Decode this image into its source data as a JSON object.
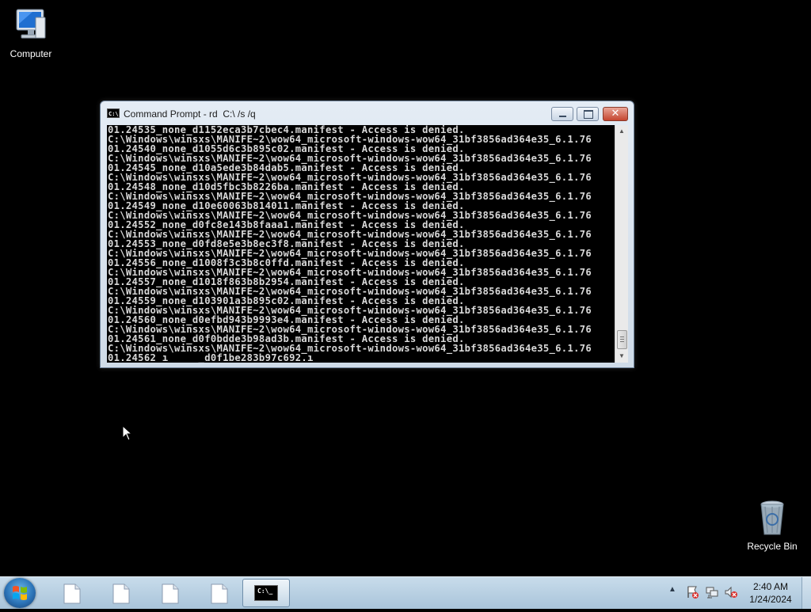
{
  "desktop": {
    "icons": [
      {
        "label": "Computer"
      },
      {
        "label": "Recycle Bin"
      }
    ]
  },
  "window": {
    "title": "Command Prompt - rd  C:\\ /s /q",
    "icon_text": "C:\\",
    "controls": {
      "minimize": "minimize",
      "maximize": "maximize",
      "close": "✕"
    }
  },
  "console": {
    "lines": [
      "01.24535_none_d1152eca3b7cbec4.manifest - Access is denied.",
      "C:\\Windows\\winsxs\\MANIFE~2\\wow64_microsoft-windows-wow64_31bf3856ad364e35_6.1.76",
      "01.24540_none_d1055d6c3b895c02.manifest - Access is denied.",
      "C:\\Windows\\winsxs\\MANIFE~2\\wow64_microsoft-windows-wow64_31bf3856ad364e35_6.1.76",
      "01.24545_none_d10a5ede3b84dab5.manifest - Access is denied.",
      "C:\\Windows\\winsxs\\MANIFE~2\\wow64_microsoft-windows-wow64_31bf3856ad364e35_6.1.76",
      "01.24548_none_d10d5fbc3b8226ba.manifest - Access is denied.",
      "C:\\Windows\\winsxs\\MANIFE~2\\wow64_microsoft-windows-wow64_31bf3856ad364e35_6.1.76",
      "01.24549_none_d10e60063b814011.manifest - Access is denied.",
      "C:\\Windows\\winsxs\\MANIFE~2\\wow64_microsoft-windows-wow64_31bf3856ad364e35_6.1.76",
      "01.24552_none_d0fc8e143b8faaa1.manifest - Access is denied.",
      "C:\\Windows\\winsxs\\MANIFE~2\\wow64_microsoft-windows-wow64_31bf3856ad364e35_6.1.76",
      "01.24553_none_d0fd8e5e3b8ec3f8.manifest - Access is denied.",
      "C:\\Windows\\winsxs\\MANIFE~2\\wow64_microsoft-windows-wow64_31bf3856ad364e35_6.1.76",
      "01.24556_none_d1008f3c3b8c0ffd.manifest - Access is denied.",
      "C:\\Windows\\winsxs\\MANIFE~2\\wow64_microsoft-windows-wow64_31bf3856ad364e35_6.1.76",
      "01.24557_none_d1018f863b8b2954.manifest - Access is denied.",
      "C:\\Windows\\winsxs\\MANIFE~2\\wow64_microsoft-windows-wow64_31bf3856ad364e35_6.1.76",
      "01.24559_none_d103901a3b895c02.manifest - Access is denied.",
      "C:\\Windows\\winsxs\\MANIFE~2\\wow64_microsoft-windows-wow64_31bf3856ad364e35_6.1.76",
      "01.24560_none_d0efbd943b9993e4.manifest - Access is denied.",
      "C:\\Windows\\winsxs\\MANIFE~2\\wow64_microsoft-windows-wow64_31bf3856ad364e35_6.1.76",
      "01.24561_none_d0f0bdde3b98ad3b.manifest - Access is denied.",
      "C:\\Windows\\winsxs\\MANIFE~2\\wow64_microsoft-windows-wow64_31bf3856ad364e35_6.1.76",
      "01.24562 ı     _d0f1be283b97c692.ı"
    ]
  },
  "taskbar": {
    "items": [
      {
        "icon": "document-icon"
      },
      {
        "icon": "document-icon"
      },
      {
        "icon": "document-icon"
      },
      {
        "icon": "document-icon"
      },
      {
        "icon": "command-prompt-icon",
        "text": "C:\\_"
      }
    ],
    "tray": {
      "icons": [
        "action-center-icon",
        "network-icon",
        "volume-muted-icon"
      ],
      "time": "2:40 AM",
      "date": "1/24/2024"
    }
  },
  "colors": {
    "desktop_bg": "#000000",
    "console_bg": "#000000",
    "console_text": "#d8d8d8",
    "taskbar": "#b8d0e3"
  }
}
